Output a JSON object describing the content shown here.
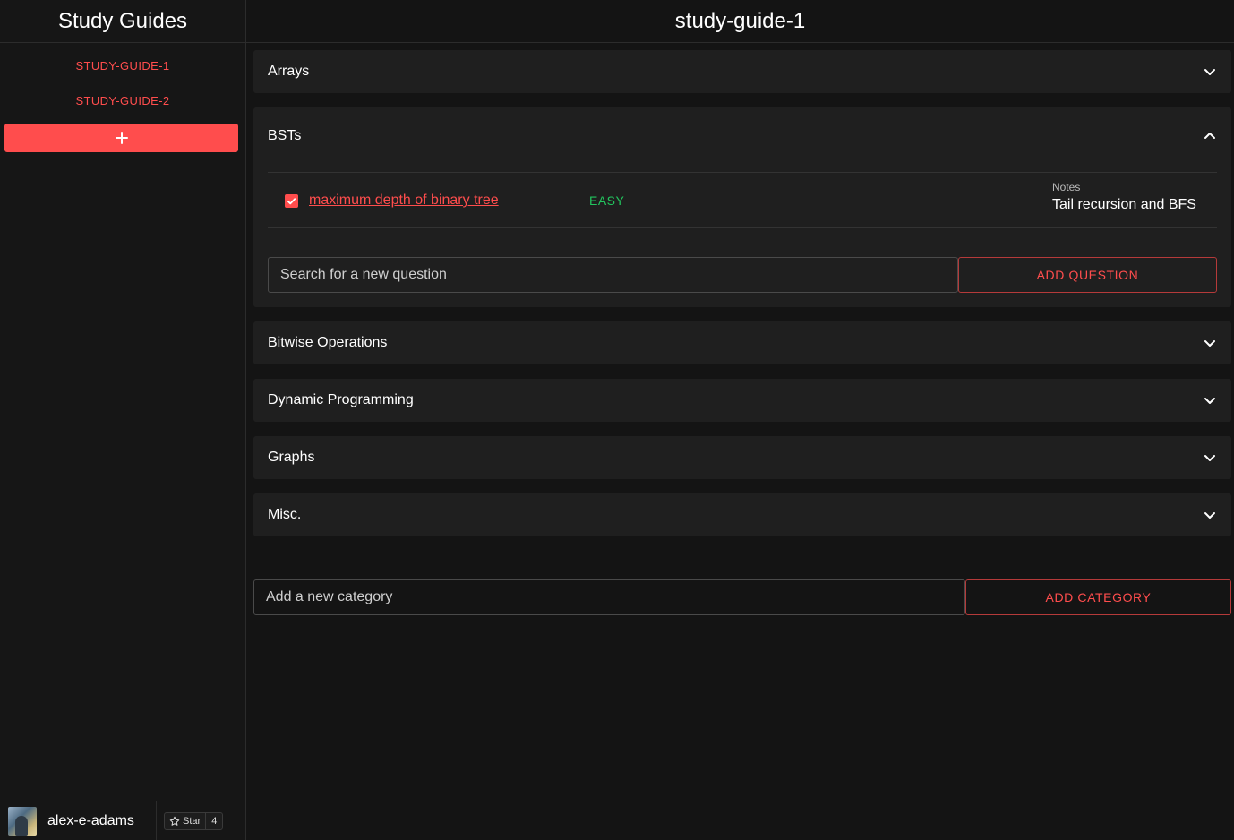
{
  "sidebar": {
    "title": "Study Guides",
    "guides": [
      "STUDY-GUIDE-1",
      "STUDY-GUIDE-2"
    ],
    "add_label": "+",
    "user": {
      "name": "alex-e-adams",
      "star_label": "Star",
      "star_count": "4"
    }
  },
  "main": {
    "title": "study-guide-1",
    "categories": {
      "arrays": "Arrays",
      "bsts": "BSTs",
      "bitwise": "Bitwise Operations",
      "dp": "Dynamic Programming",
      "graphs": "Graphs",
      "misc": "Misc."
    },
    "bst_question": {
      "title": "maximum depth of binary tree",
      "difficulty": "EASY",
      "notes_label": "Notes",
      "notes_value": "Tail recursion and BFS",
      "checked": true
    },
    "question_search_placeholder": "Search for a new question",
    "add_question_label": "ADD QUESTION",
    "category_input_placeholder": "Add a new category",
    "add_category_label": "ADD CATEGORY"
  },
  "colors": {
    "accent": "#ff4d4d",
    "easy": "#22c55e",
    "panel": "#1f1f1f",
    "background": "#141414"
  }
}
